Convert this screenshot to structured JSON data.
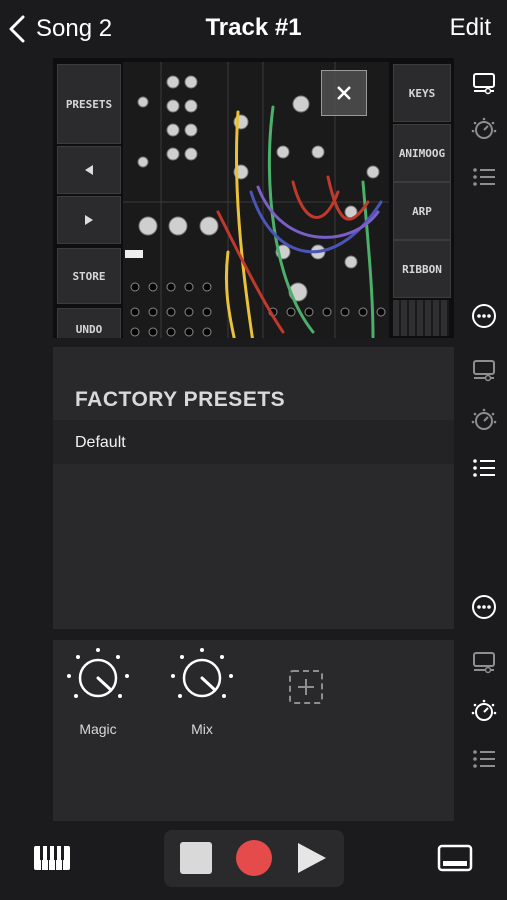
{
  "header": {
    "back_label": "Song 2",
    "title": "Track #1",
    "edit_label": "Edit"
  },
  "synth": {
    "left_buttons": [
      "PRESETS",
      "STORE",
      "UNDO"
    ],
    "right_buttons": [
      "KEYS",
      "ANIMOOG",
      "ARP",
      "RIBBON"
    ],
    "close_icon": "close-icon"
  },
  "presets": {
    "heading": "FACTORY PRESETS",
    "items": [
      "Default"
    ]
  },
  "fx": {
    "knobs": [
      {
        "label": "Magic"
      },
      {
        "label": "Mix"
      }
    ],
    "add_icon": "add-slot-icon"
  },
  "rail": {
    "groups": [
      [
        "display-icon",
        "gauge-icon",
        "list-icon",
        "more-icon"
      ],
      [
        "display-icon",
        "gauge-icon",
        "list-icon",
        "more-icon"
      ],
      [
        "display-icon",
        "gauge-icon",
        "list-icon"
      ]
    ]
  },
  "transport": {
    "stop": "stop-icon",
    "record": "record-icon",
    "play": "play-icon"
  },
  "colors": {
    "background": "#1b1b1d",
    "panel": "#29292b",
    "record": "#e64b4b",
    "cable_yellow": "#e8c23b",
    "cable_green": "#4caf6a",
    "cable_red": "#c0392b",
    "cable_blue": "#4b55b8"
  }
}
